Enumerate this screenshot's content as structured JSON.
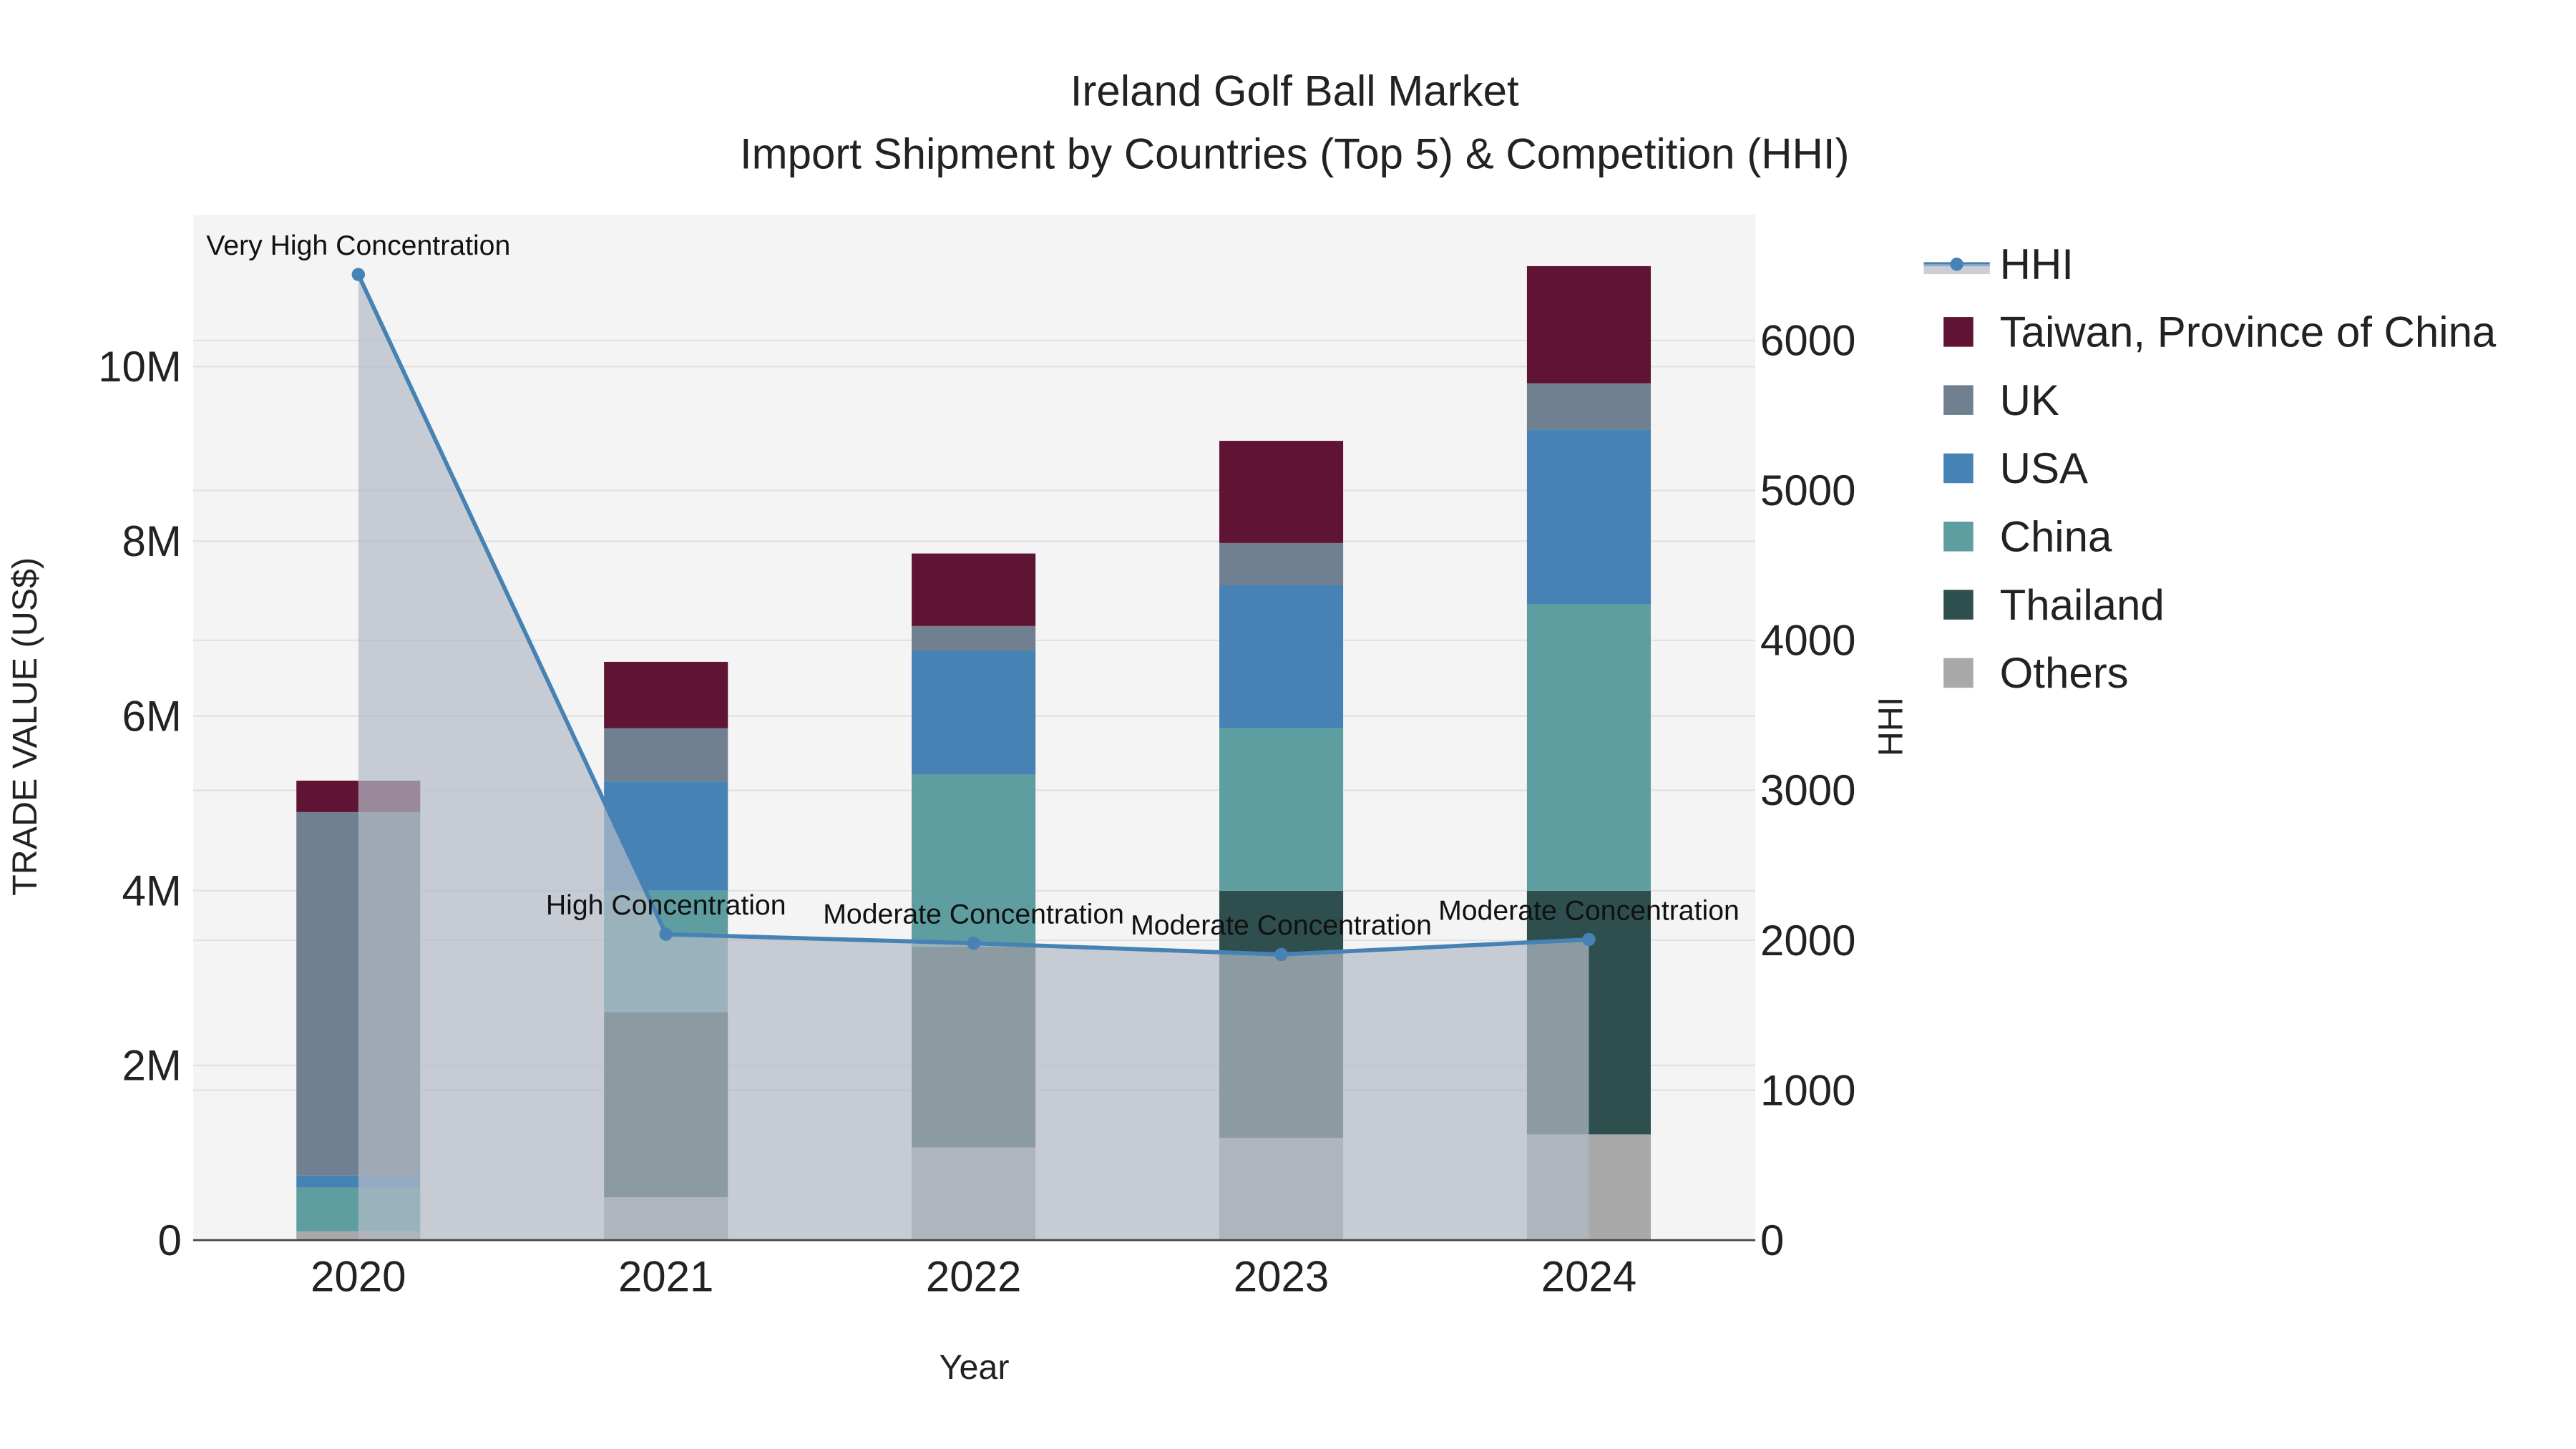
{
  "chart_data": {
    "type": "bar",
    "title": "Ireland Golf Ball Market",
    "subtitle": "Import Shipment by Countries (Top 5) & Competition (HHI)",
    "xlabel": "Year",
    "ylabel": "TRADE VALUE (US$)",
    "y2label": "HHI",
    "categories": [
      "2020",
      "2021",
      "2022",
      "2023",
      "2024"
    ],
    "ylim": [
      0,
      11700000
    ],
    "y2lim": [
      0,
      6800
    ],
    "yticks": [
      0,
      2000000,
      4000000,
      6000000,
      8000000,
      10000000
    ],
    "ytick_labels": [
      "0",
      "2M",
      "4M",
      "6M",
      "8M",
      "10M"
    ],
    "y2ticks": [
      0,
      1000,
      2000,
      3000,
      4000,
      5000,
      6000
    ],
    "y2tick_labels": [
      "0",
      "1000",
      "2000",
      "3000",
      "4000",
      "5000",
      "6000"
    ],
    "grid": true,
    "legend_position": "right",
    "series": [
      {
        "name": "Others",
        "color": "#a9a9a9",
        "values": [
          100000,
          490000,
          1060000,
          1170000,
          1210000
        ]
      },
      {
        "name": "Thailand",
        "color": "#2f4f4f",
        "values": [
          0,
          2120000,
          2300000,
          2830000,
          2790000
        ]
      },
      {
        "name": "China",
        "color": "#5f9ea0",
        "values": [
          500000,
          1390000,
          1970000,
          1860000,
          3280000
        ]
      },
      {
        "name": "USA",
        "color": "#4682b4",
        "values": [
          140000,
          1250000,
          1420000,
          1640000,
          2000000
        ]
      },
      {
        "name": "UK",
        "color": "#708090",
        "values": [
          4160000,
          610000,
          280000,
          480000,
          530000
        ]
      },
      {
        "name": "Taiwan, Province of China",
        "color": "#5f1434",
        "values": [
          360000,
          760000,
          830000,
          1170000,
          1340000
        ]
      }
    ],
    "hhi": {
      "name": "HHI",
      "color": "#4682b4",
      "values": [
        6440,
        2040,
        1980,
        1905,
        2005
      ],
      "annotations": [
        "Very High Concentration",
        "High Concentration",
        "Moderate Concentration",
        "Moderate Concentration",
        "Moderate Concentration"
      ]
    }
  }
}
